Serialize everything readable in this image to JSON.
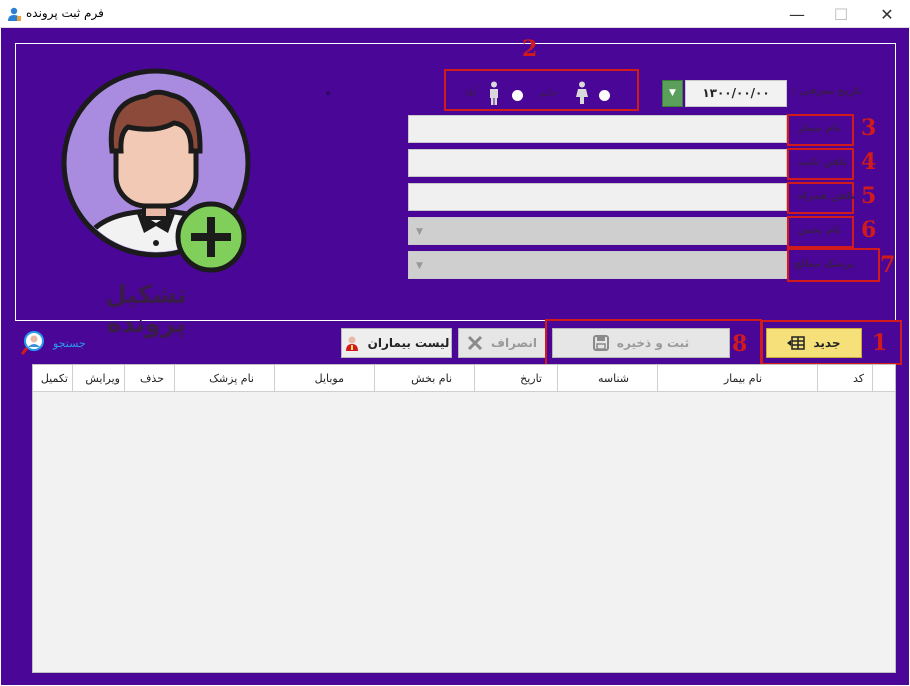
{
  "window": {
    "title": "فرم ثبت پرونده",
    "min_glyph": "—",
    "max_glyph": "☐",
    "close_glyph": "✕"
  },
  "avatar": {
    "caption": "تشکیل پرونده"
  },
  "form": {
    "intro_date_label": "تاریخ معرفی :",
    "intro_date_value": "۱۳۰۰/۰۰/۰۰",
    "gender": {
      "female_label": "خانم",
      "male_label": "آقا"
    },
    "patient_name_label": "نام بیمار",
    "phone_label": "تلفن ثابت",
    "mobile_label": "تلفن همراه",
    "department_label": "نام بخش",
    "doctor_label": "پزشک معالج",
    "dot": "ه"
  },
  "annotations": [
    "1",
    "2",
    "3",
    "4",
    "5",
    "6",
    "7",
    "8"
  ],
  "toolbar": {
    "new_label": "جدید",
    "save_label": "ثبت و ذخیره",
    "cancel_label": "انصراف",
    "patients_label": "لیست بیماران",
    "search_label": "جستجو"
  },
  "grid": {
    "columns": [
      "کد",
      "نام بیمار",
      "شناسه",
      "تاریخ",
      "نام بخش",
      "موبایل",
      "نام پزشک",
      "حذف",
      "ویرایش",
      "تکمیل"
    ],
    "rows": []
  },
  "colors": {
    "background": "#4a0696",
    "annotation_red": "#d11b1b",
    "new_button": "#f5e07a",
    "search_link": "#2a9af0"
  }
}
